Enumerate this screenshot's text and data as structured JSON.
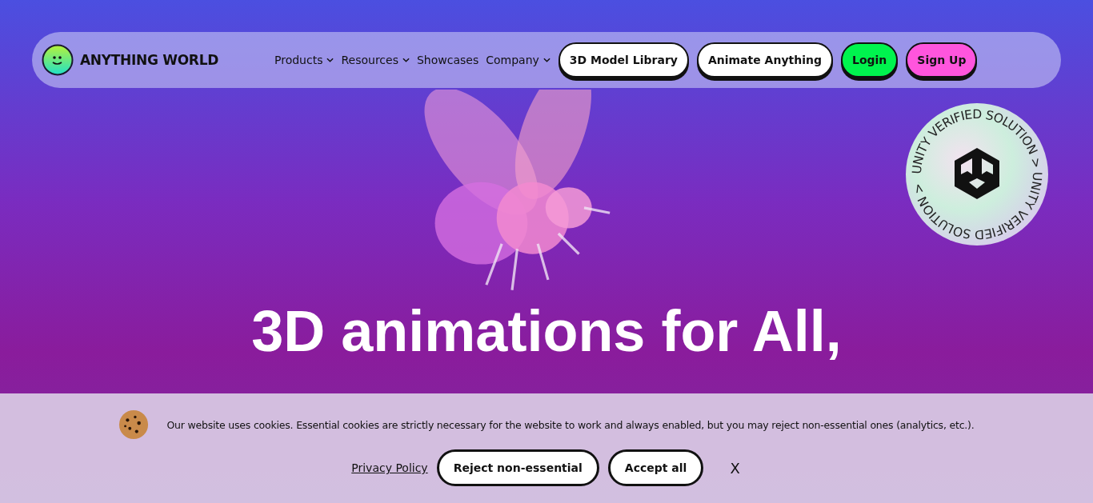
{
  "nav": {
    "brand": "ANYTHING WORLD",
    "menu": [
      {
        "label": "Products",
        "dropdown": true
      },
      {
        "label": "Resources",
        "dropdown": true
      },
      {
        "label": "Showcases",
        "dropdown": false
      },
      {
        "label": "Company",
        "dropdown": true
      }
    ],
    "buttons": [
      {
        "label": "3D Model Library",
        "kind": "plain"
      },
      {
        "label": "Animate Anything",
        "kind": "plain"
      },
      {
        "label": "Login",
        "kind": "login"
      },
      {
        "label": "Sign Up",
        "kind": "signup"
      }
    ]
  },
  "badge": {
    "ring_text": "UNITY VERIFIED SOLUTION > UNITY VERIFIED SOLUTION >"
  },
  "hero": {
    "headline": "3D animations for All,"
  },
  "cookie_banner": {
    "message": "Our website uses cookies. Essential cookies are strictly necessary for the website to work and always enabled, but you may reject non-essential ones (analytics, etc.).",
    "privacy_link": "Privacy Policy",
    "reject": "Reject non-essential",
    "accept": "Accept all",
    "close": "X"
  }
}
